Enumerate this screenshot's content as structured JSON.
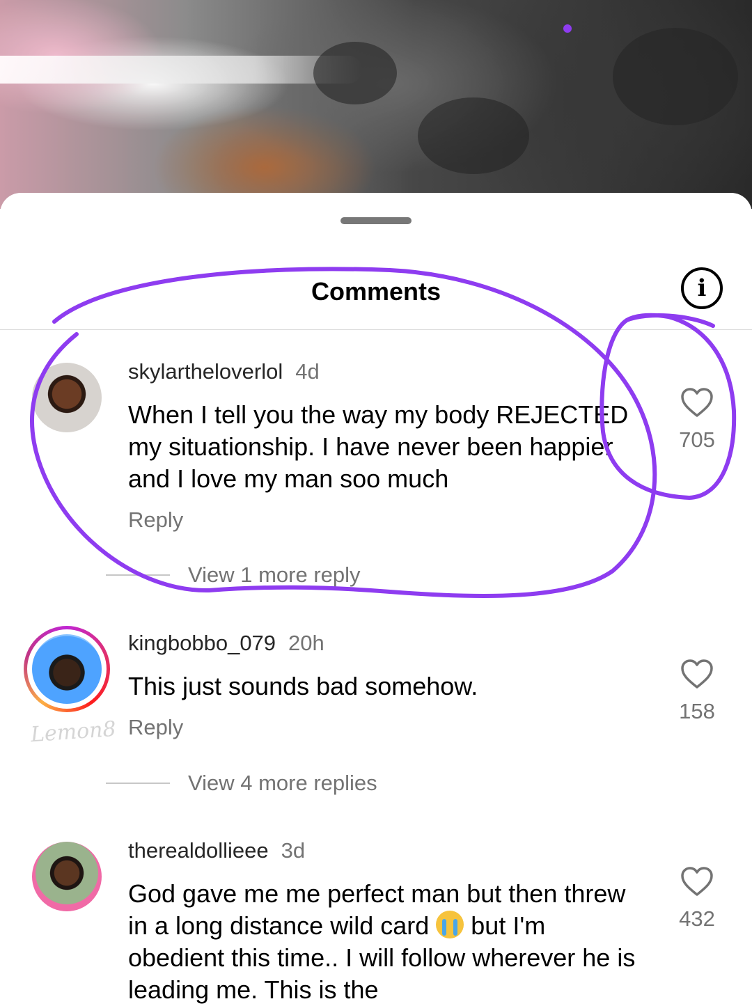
{
  "sheet": {
    "title": "Comments",
    "info_icon_glyph": "i"
  },
  "comments": [
    {
      "username": "skylartheloverlol",
      "time": "4d",
      "text": "When I tell you the way my body REJECTED my situationship. I have never been happier and I love my man soo much",
      "reply_label": "Reply",
      "view_replies": "View 1 more reply",
      "likes": "705"
    },
    {
      "username": "kingbobbo_079",
      "time": "20h",
      "text": "This just sounds bad somehow.",
      "reply_label": "Reply",
      "view_replies": "View 4 more replies",
      "likes": "158"
    },
    {
      "username": "therealdollieee",
      "time": "3d",
      "text_part1": "God gave me me perfect man but then threw in a long distance wild card",
      "text_part2": "but I'm obedient this time.. I will follow wherever he is leading me. This is the",
      "likes": "432"
    }
  ],
  "watermark": "Lemon8",
  "annotation_color": "#8e3cf0"
}
